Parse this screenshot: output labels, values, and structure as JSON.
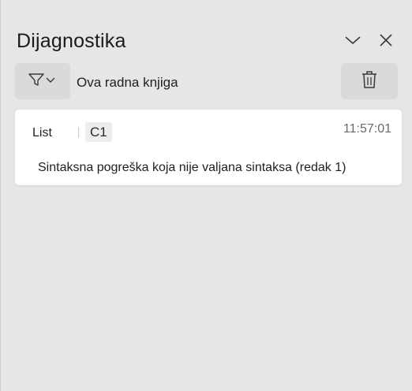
{
  "panel": {
    "title": "Dijagnostika",
    "collapse_icon": "chevron-down-icon",
    "close_icon": "close-icon"
  },
  "toolbar": {
    "filter_icon": "filter-icon",
    "scope_label": "Ova radna knjiga",
    "clear_icon": "trash-icon"
  },
  "entries": [
    {
      "sheet": "List",
      "cell": "C1",
      "time": "11:57:01",
      "message": "Sintaksna pogreška koja nije valjana sintaksa (redak 1)"
    }
  ]
}
